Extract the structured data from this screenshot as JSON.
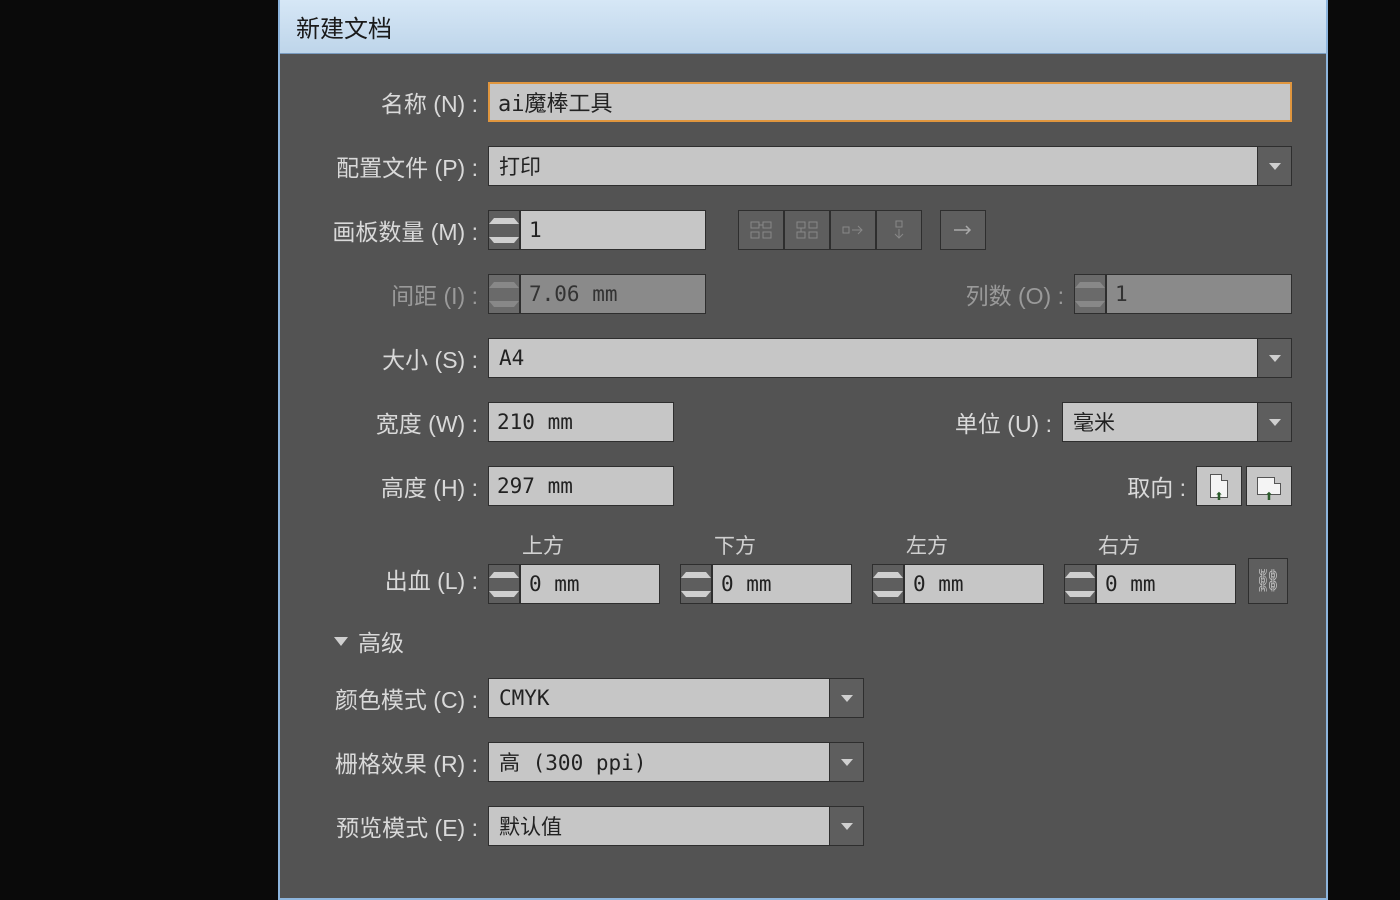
{
  "dialog": {
    "title": "新建文档",
    "name_label": "名称 (N) :",
    "name_value": "ai魔棒工具",
    "profile_label": "配置文件 (P) :",
    "profile_value": "打印",
    "artboards_label": "画板数量 (M) :",
    "artboards_value": "1",
    "spacing_label": "间距 (I) :",
    "spacing_value": "7.06 mm",
    "columns_label": "列数 (O) :",
    "columns_value": "1",
    "size_label": "大小 (S) :",
    "size_value": "A4",
    "width_label": "宽度 (W) :",
    "width_value": "210 mm",
    "units_label": "单位 (U) :",
    "units_value": "毫米",
    "height_label": "高度 (H) :",
    "height_value": "297 mm",
    "orient_label": "取向 :",
    "bleed_label": "出血 (L) :",
    "bleed": {
      "top": {
        "label": "上方",
        "value": "0 mm"
      },
      "bottom": {
        "label": "下方",
        "value": "0 mm"
      },
      "left": {
        "label": "左方",
        "value": "0 mm"
      },
      "right": {
        "label": "右方",
        "value": "0 mm"
      }
    },
    "advanced_label": "高级",
    "color_mode_label": "颜色模式 (C) :",
    "color_mode_value": "CMYK",
    "raster_label": "栅格效果 (R) :",
    "raster_value": "高 (300 ppi)",
    "preview_label": "预览模式 (E) :",
    "preview_value": "默认值"
  }
}
